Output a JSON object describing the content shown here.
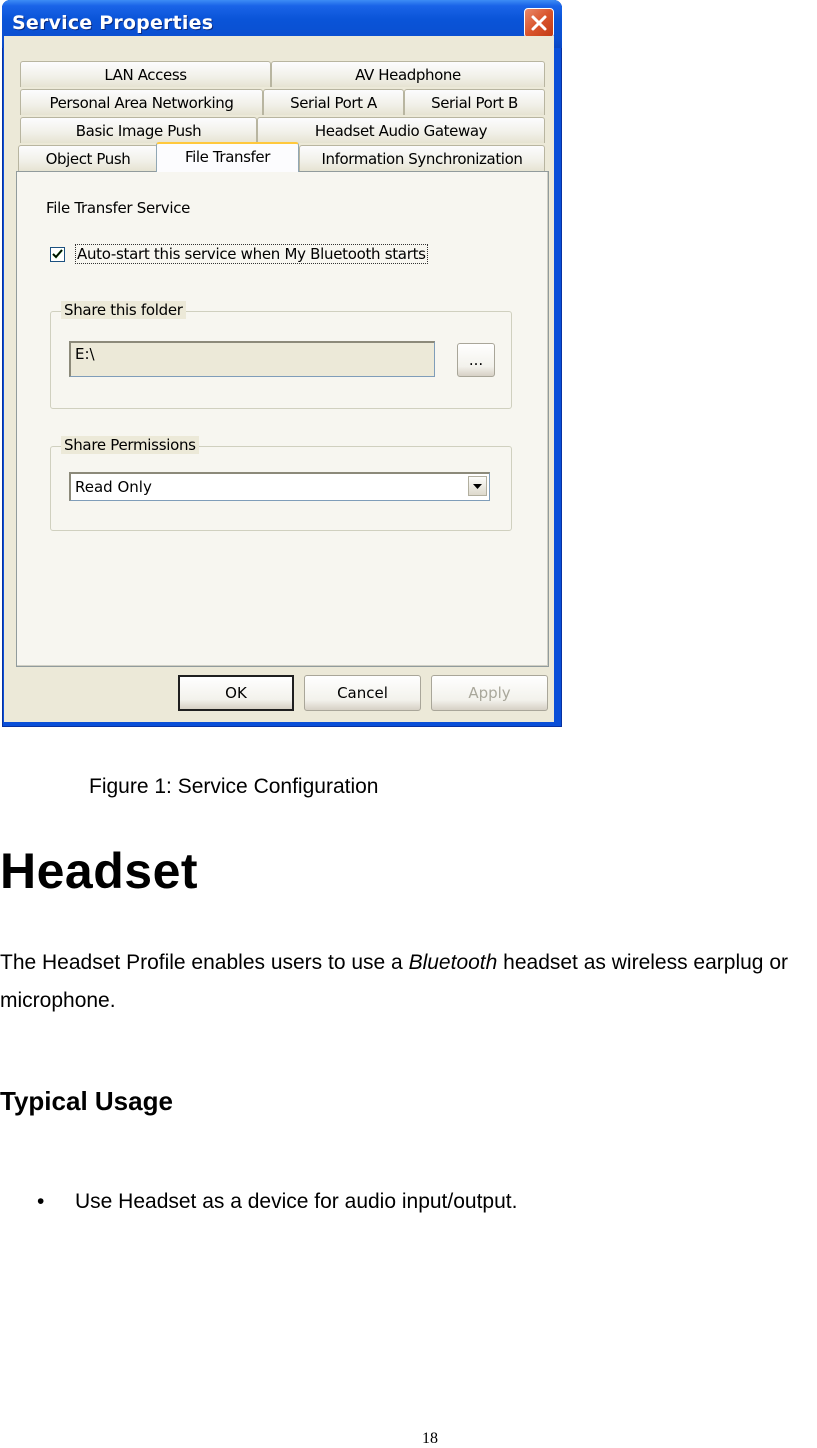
{
  "dialog": {
    "title": "Service Properties",
    "tabs": {
      "row1": [
        {
          "label": "LAN Access"
        },
        {
          "label": "AV Headphone"
        }
      ],
      "row2": [
        {
          "label": "Personal Area Networking"
        },
        {
          "label": "Serial Port A"
        },
        {
          "label": "Serial Port B"
        }
      ],
      "row3": [
        {
          "label": "Basic Image Push"
        },
        {
          "label": "Headset Audio Gateway"
        }
      ],
      "row4": [
        {
          "label": "Object Push"
        },
        {
          "label": "File Transfer",
          "selected": true
        },
        {
          "label": "Information Synchronization"
        }
      ]
    },
    "panel": {
      "service_title": "File Transfer Service",
      "autostart_label": "Auto-start this service when My Bluetooth starts",
      "autostart_checked": true,
      "share_folder_label": "Share this folder",
      "share_folder_value": "E:\\",
      "browse_label": "...",
      "share_permissions_label": "Share Permissions",
      "share_permissions_value": "Read Only"
    },
    "buttons": {
      "ok": "OK",
      "cancel": "Cancel",
      "apply": "Apply"
    }
  },
  "document": {
    "caption": "Figure 1: Service Configuration",
    "heading": "Headset",
    "paragraph_before": "The Headset Profile enables users to use a ",
    "paragraph_italic": "Bluetooth",
    "paragraph_after": " headset as wireless earplug or microphone.",
    "subheading": "Typical Usage",
    "bullets": [
      {
        "glyph": "•",
        "text": "Use Headset as a device for audio input/output."
      }
    ],
    "page_number": "18"
  }
}
